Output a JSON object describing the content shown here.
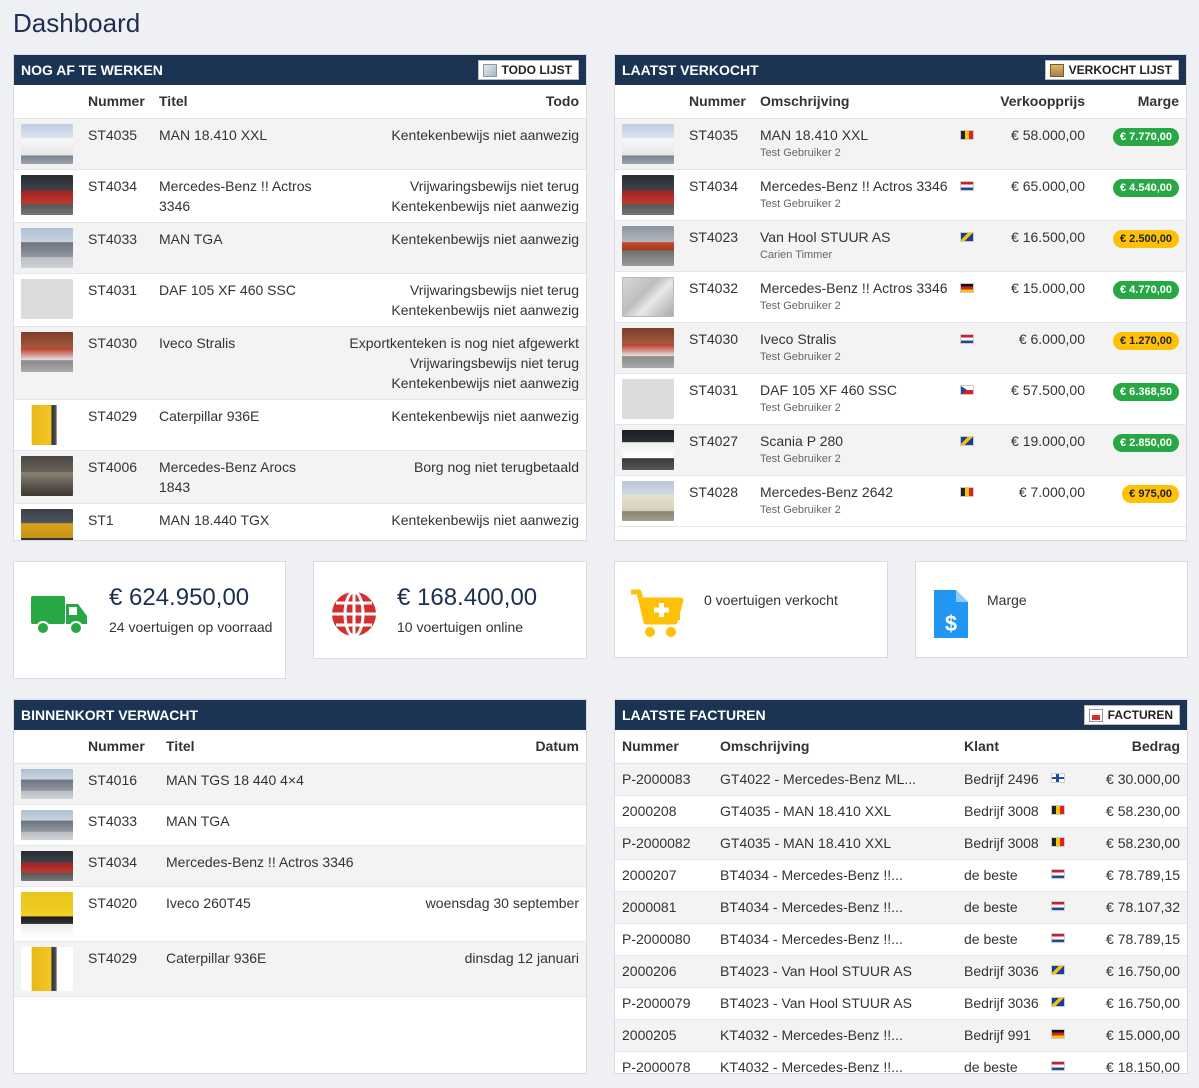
{
  "page": {
    "title": "Dashboard"
  },
  "todo": {
    "title": "NOG AF TE WERKEN",
    "button": "TODO LIJST",
    "headers": {
      "nummer": "Nummer",
      "titel": "Titel",
      "todo": "Todo"
    },
    "rows": [
      {
        "thumb": "trailer",
        "nummer": "ST4035",
        "titel": "MAN 18.410 XXL",
        "todo": [
          "Kentekenbewijs niet aanwezig"
        ]
      },
      {
        "thumb": "redtruck",
        "nummer": "ST4034",
        "titel": "Mercedes-Benz !! Actros 3346",
        "todo": [
          "Vrijwaringsbewijs niet terug",
          "Kentekenbewijs niet aanwezig"
        ]
      },
      {
        "thumb": "greytruck",
        "nummer": "ST4033",
        "titel": "MAN TGA",
        "todo": [
          "Kentekenbewijs niet aanwezig"
        ]
      },
      {
        "thumb": "empty",
        "nummer": "ST4031",
        "titel": "DAF 105 XF 460 SSC",
        "todo": [
          "Vrijwaringsbewijs niet terug",
          "Kentekenbewijs niet aanwezig"
        ]
      },
      {
        "thumb": "redwall",
        "nummer": "ST4030",
        "titel": "Iveco Stralis",
        "todo": [
          "Exportkenteken is nog niet afgewerkt",
          "Vrijwaringsbewijs niet terug",
          "Kentekenbewijs niet aanwezig"
        ]
      },
      {
        "thumb": "cat",
        "nummer": "ST4029",
        "titel": "Caterpillar 936E",
        "todo": [
          "Kentekenbewijs niet aanwezig"
        ]
      },
      {
        "thumb": "arocs",
        "nummer": "ST4006",
        "titel": "Mercedes-Benz Arocs 1843",
        "todo": [
          "Borg nog niet terugbetaald"
        ]
      },
      {
        "thumb": "yellowtrk",
        "nummer": "ST1",
        "titel": "MAN 18.440 TGX",
        "todo": [
          "Kentekenbewijs niet aanwezig"
        ]
      }
    ]
  },
  "sold": {
    "title": "LAATST VERKOCHT",
    "button": "VERKOCHT LIJST",
    "headers": {
      "nummer": "Nummer",
      "omschrijving": "Omschrijving",
      "prijs": "Verkoopprijs",
      "marge": "Marge"
    },
    "rows": [
      {
        "thumb": "trailer",
        "nummer": "ST4035",
        "omschrijving": "MAN 18.410 XXL",
        "sub": "Test Gebruiker 2",
        "flag": "be",
        "prijs": "€ 58.000,00",
        "marge": "€ 7.770,00",
        "badge": "green"
      },
      {
        "thumb": "redtruck",
        "nummer": "ST4034",
        "omschrijving": "Mercedes-Benz !! Actros 3346",
        "sub": "Test Gebruiker 2",
        "flag": "nl",
        "prijs": "€ 65.000,00",
        "marge": "€ 4.540,00",
        "badge": "green"
      },
      {
        "thumb": "flatbed",
        "nummer": "ST4023",
        "omschrijving": "Van Hool STUUR AS",
        "sub": "Carien Timmer",
        "flag": "ba",
        "prijs": "€ 16.500,00",
        "marge": "€ 2.500,00",
        "badge": "yellow"
      },
      {
        "thumb": "engine",
        "nummer": "ST4032",
        "omschrijving": "Mercedes-Benz !! Actros 3346",
        "sub": "Test Gebruiker 2",
        "flag": "de",
        "prijs": "€ 15.000,00",
        "marge": "€ 4.770,00",
        "badge": "green"
      },
      {
        "thumb": "redwall",
        "nummer": "ST4030",
        "omschrijving": "Iveco Stralis",
        "sub": "Test Gebruiker 2",
        "flag": "nl",
        "prijs": "€ 6.000,00",
        "marge": "€ 1.270,00",
        "badge": "yellow"
      },
      {
        "thumb": "empty",
        "nummer": "ST4031",
        "omschrijving": "DAF 105 XF 460 SSC",
        "sub": "Test Gebruiker 2",
        "flag": "cz",
        "prijs": "€ 57.500,00",
        "marge": "€ 6.368,50",
        "badge": "green"
      },
      {
        "thumb": "scania",
        "nummer": "ST4027",
        "omschrijving": "Scania P 280",
        "sub": "Test Gebruiker 2",
        "flag": "ba",
        "prijs": "€ 19.000,00",
        "marge": "€ 2.850,00",
        "badge": "green"
      },
      {
        "thumb": "mb2642",
        "nummer": "ST4028",
        "omschrijving": "Mercedes-Benz 2642",
        "sub": "Test Gebruiker 2",
        "flag": "be",
        "prijs": "€ 7.000,00",
        "marge": "€ 975,00",
        "badge": "yellow"
      }
    ]
  },
  "stats": {
    "stock": {
      "value": "€ 624.950,00",
      "label": "24 voertuigen op voorraad",
      "color": "#28a745"
    },
    "online": {
      "value": "€ 168.400,00",
      "label": "10 voertuigen online",
      "color": "#d32f2f"
    },
    "sold": {
      "label": "0 voertuigen verkocht",
      "color": "#ffc107"
    },
    "marge": {
      "label": "Marge",
      "color": "#2196f3"
    }
  },
  "expected": {
    "title": "BINNENKORT VERWACHT",
    "headers": {
      "nummer": "Nummer",
      "titel": "Titel",
      "datum": "Datum"
    },
    "rows": [
      {
        "thumb": "greytruck",
        "nummer": "ST4016",
        "titel": "MAN TGS 18 440 4×4",
        "datum": ""
      },
      {
        "thumb": "greytruck",
        "nummer": "ST4033",
        "titel": "MAN TGA",
        "datum": ""
      },
      {
        "thumb": "redtruck",
        "nummer": "ST4034",
        "titel": "Mercedes-Benz !! Actros 3346",
        "datum": ""
      },
      {
        "thumb": "iveco",
        "nummer": "ST4020",
        "titel": "Iveco 260T45",
        "datum": "woensdag 30 september"
      },
      {
        "thumb": "cat",
        "nummer": "ST4029",
        "titel": "Caterpillar 936E",
        "datum": "dinsdag 12 januari"
      }
    ]
  },
  "invoices": {
    "title": "LAATSTE FACTUREN",
    "button": "FACTUREN",
    "headers": {
      "nummer": "Nummer",
      "omschrijving": "Omschrijving",
      "klant": "Klant",
      "bedrag": "Bedrag"
    },
    "rows": [
      {
        "nummer": "P-2000083",
        "omschrijving": "GT4022 - Mercedes-Benz ML...",
        "klant": "Bedrijf 2496",
        "flag": "fi",
        "bedrag": "€ 30.000,00"
      },
      {
        "nummer": "2000208",
        "omschrijving": "GT4035 - MAN 18.410 XXL",
        "klant": "Bedrijf 3008",
        "flag": "be",
        "bedrag": "€ 58.230,00"
      },
      {
        "nummer": "P-2000082",
        "omschrijving": "GT4035 - MAN 18.410 XXL",
        "klant": "Bedrijf 3008",
        "flag": "be",
        "bedrag": "€ 58.230,00"
      },
      {
        "nummer": "2000207",
        "omschrijving": "BT4034 - Mercedes-Benz !!...",
        "klant": "de beste",
        "flag": "nl",
        "bedrag": "€ 78.789,15"
      },
      {
        "nummer": "2000081",
        "omschrijving": "BT4034 - Mercedes-Benz !!...",
        "klant": "de beste",
        "flag": "nl",
        "bedrag": "€ 78.107,32"
      },
      {
        "nummer": "P-2000080",
        "omschrijving": "BT4034 - Mercedes-Benz !!...",
        "klant": "de beste",
        "flag": "nl",
        "bedrag": "€ 78.789,15"
      },
      {
        "nummer": "2000206",
        "omschrijving": "BT4023 - Van Hool STUUR AS",
        "klant": "Bedrijf 3036",
        "flag": "ba",
        "bedrag": "€ 16.750,00"
      },
      {
        "nummer": "P-2000079",
        "omschrijving": "BT4023 - Van Hool STUUR AS",
        "klant": "Bedrijf 3036",
        "flag": "ba",
        "bedrag": "€ 16.750,00"
      },
      {
        "nummer": "2000205",
        "omschrijving": "KT4032 - Mercedes-Benz !!...",
        "klant": "Bedrijf 991",
        "flag": "de",
        "bedrag": "€ 15.000,00"
      },
      {
        "nummer": "P-2000078",
        "omschrijving": "KT4032 - Mercedes-Benz !!...",
        "klant": "de beste",
        "flag": "nl",
        "bedrag": "€ 18.150,00"
      }
    ]
  }
}
